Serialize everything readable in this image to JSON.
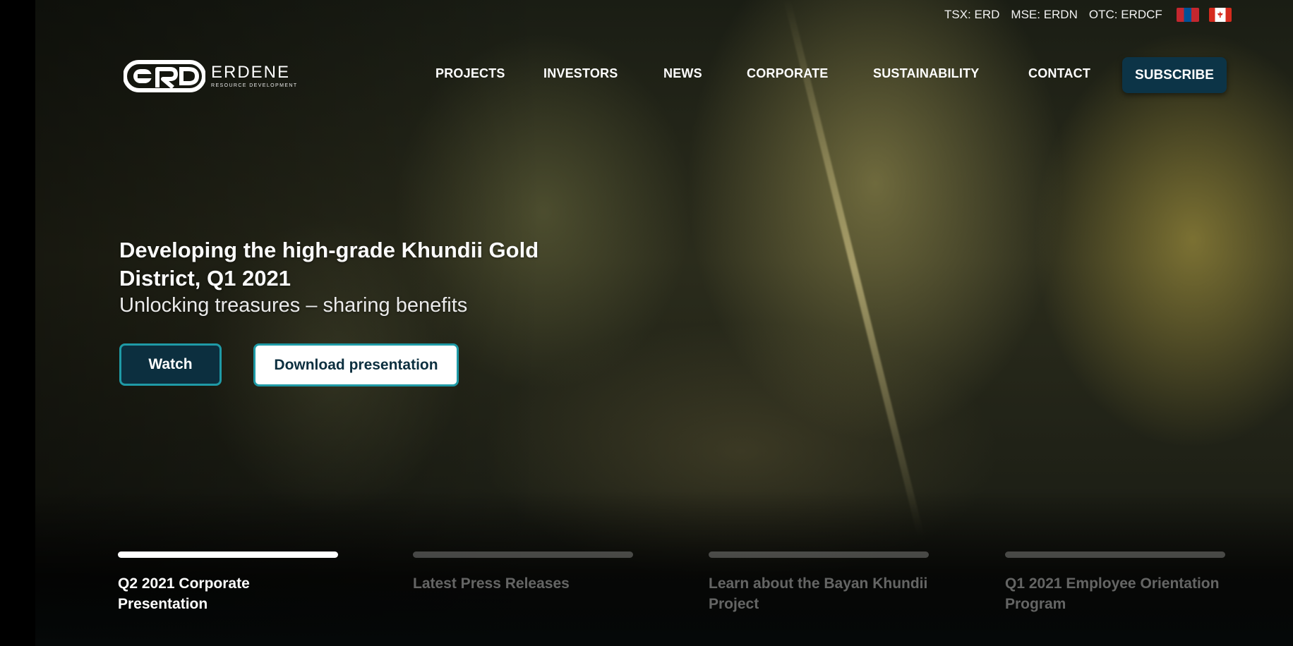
{
  "ticker": {
    "tsx": "TSX: ERD",
    "mse": "MSE: ERDN",
    "otc": "OTC: ERDCF"
  },
  "logo": {
    "name": "ERDENE",
    "tagline": "RESOURCE DEVELOPMENT"
  },
  "nav": {
    "items": [
      {
        "label": "PROJECTS"
      },
      {
        "label": "INVESTORS"
      },
      {
        "label": "NEWS"
      },
      {
        "label": "CORPORATE"
      },
      {
        "label": "SUSTAINABILITY"
      },
      {
        "label": "CONTACT"
      }
    ],
    "subscribe_label": "SUBSCRIBE"
  },
  "hero": {
    "headline": "Developing the high-grade Khundii Gold District, Q1 2021",
    "subline": "Unlocking treasures – sharing benefits",
    "watch_label": "Watch",
    "download_label": "Download presentation"
  },
  "slides": [
    {
      "label": "Q2 2021 Corporate Presentation",
      "active": true
    },
    {
      "label": "Latest Press Releases",
      "active": false
    },
    {
      "label": "Learn about the Bayan Khundii Project",
      "active": false
    },
    {
      "label": "Q1 2021 Employee Orientation Program",
      "active": false
    }
  ],
  "colors": {
    "brand_navy": "#0c3447",
    "accent_teal": "#1f9aa6"
  }
}
